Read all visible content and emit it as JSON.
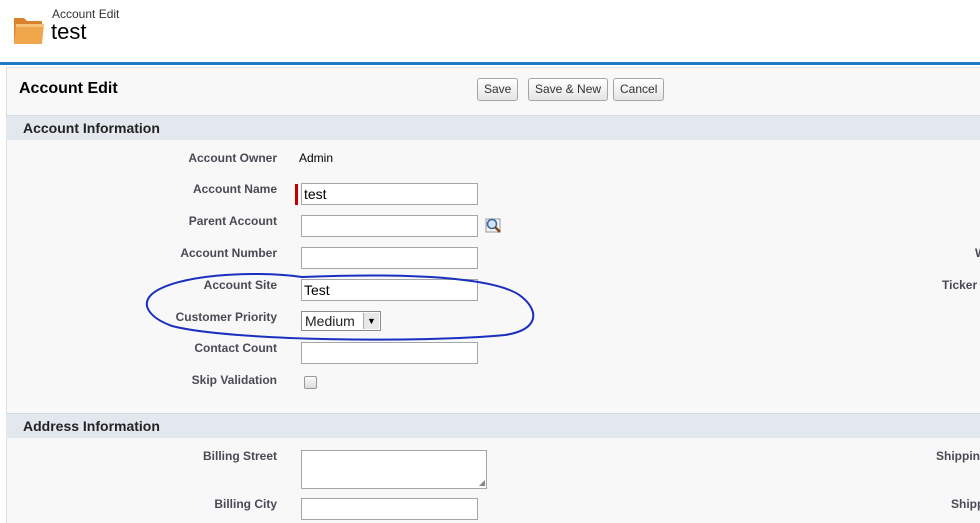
{
  "header": {
    "subtitle": "Account Edit",
    "title": "test"
  },
  "panel": {
    "title": "Account Edit",
    "buttons": {
      "save": "Save",
      "save_new": "Save & New",
      "cancel": "Cancel"
    }
  },
  "sections": {
    "account_info": "Account Information",
    "address_info": "Address Information"
  },
  "fields": {
    "owner_label": "Account Owner",
    "owner_value": "Admin",
    "name_label": "Account Name",
    "name_value": "test",
    "parent_label": "Parent Account",
    "parent_value": "",
    "number_label": "Account Number",
    "number_value": "",
    "site_label": "Account Site",
    "site_value": "Test",
    "priority_label": "Customer Priority",
    "priority_value": "Medium",
    "contact_label": "Contact Count",
    "contact_value": "",
    "skip_label": "Skip Validation",
    "billing_street_label": "Billing Street",
    "billing_city_label": "Billing City",
    "billing_city_value": ""
  },
  "right_labels": {
    "w": "W",
    "ticker": "Ticker",
    "shipping_1": "Shipping",
    "shipping_2": "Shipp"
  },
  "icons": {
    "folder": "folder-icon",
    "lookup": "lookup-magnifier-icon",
    "dropdown": "chevron-down-icon"
  },
  "colors": {
    "accent": "#1f7cc4",
    "required": "#c00000",
    "annotation": "#1b2fbf"
  }
}
